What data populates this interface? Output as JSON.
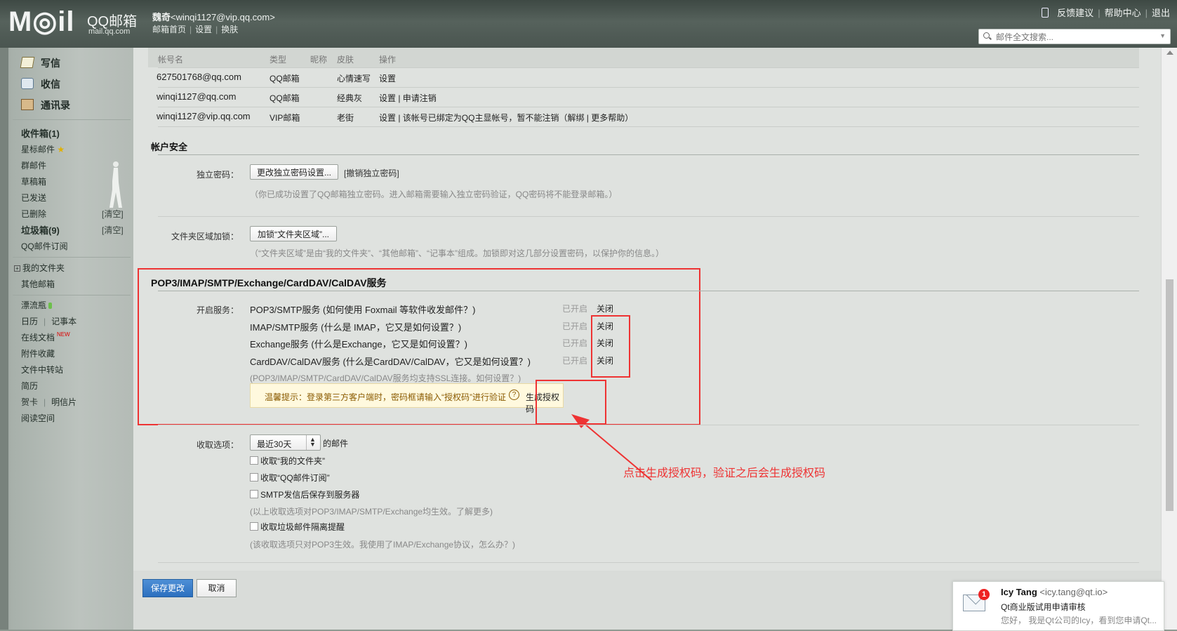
{
  "header": {
    "logo": "M◎il",
    "logo_cn": "QQ邮箱",
    "logo_url": "mail.qq.com",
    "user_name": "魏奇",
    "user_email": "<winqi1127@vip.qq.com>",
    "subnav": [
      "邮箱首页",
      "设置",
      "换肤"
    ],
    "toplinks": [
      "反馈建议",
      "帮助中心",
      "退出"
    ],
    "search_placeholder": "邮件全文搜索..."
  },
  "sidebar": {
    "compose": "写信",
    "receive": "收信",
    "contacts": "通讯录",
    "folders": [
      {
        "label": "收件箱(1)"
      },
      {
        "label": "星标邮件"
      },
      {
        "label": "群邮件"
      },
      {
        "label": "草稿箱"
      },
      {
        "label": "已发送"
      },
      {
        "label": "已删除"
      },
      {
        "label": "垃圾箱(9)"
      },
      {
        "label": "QQ邮件订阅"
      }
    ],
    "clear_label": "[清空]",
    "my_folders": "我的文件夹",
    "other_mail": "其他邮箱",
    "drift_bottle": "漂流瓶",
    "calendar": "日历",
    "notepad": "记事本",
    "online_docs": "在线文档",
    "new_badge": "NEW",
    "attachments": "附件收藏",
    "file_transfer": "文件中转站",
    "resume": "简历",
    "greeting_card": "贺卡",
    "postcard": "明信片",
    "reading_space": "阅读空间"
  },
  "accounts": {
    "headers": [
      "帐号名",
      "类型",
      "昵称",
      "皮肤",
      "操作"
    ],
    "rows": [
      {
        "name": "627501768@qq.com",
        "type": "QQ邮箱",
        "nick": "",
        "skin": "心情速写",
        "ops": "设置"
      },
      {
        "name": "winqi1127@qq.com",
        "type": "QQ邮箱",
        "nick": "",
        "skin": "经典灰",
        "ops": "设置 |  申请注销"
      },
      {
        "name": "winqi1127@vip.qq.com",
        "type": "VIP邮箱",
        "nick": "",
        "skin": "老街",
        "ops": "设置 |  该帐号已绑定为QQ主显帐号，暂不能注销（解绑 | 更多帮助）"
      }
    ]
  },
  "security": {
    "title": "帐户安全",
    "pwd_label": "独立密码：",
    "pwd_button": "更改独立密码设置...",
    "pwd_cancel": "[撤销独立密码]",
    "pwd_hint": "（你已成功设置了QQ邮箱独立密码。进入邮箱需要输入独立密码验证，QQ密码将不能登录邮箱。）",
    "folder_label": "文件夹区域加锁：",
    "folder_button": "加锁“文件夹区域”...",
    "folder_hint": "（“文件夹区域”是由“我的文件夹”、“其他邮箱”、“记事本”组成。加锁即对这几部分设置密码，以保护你的信息。）"
  },
  "services": {
    "title": "POP3/IMAP/SMTP/Exchange/CardDAV/CalDAV服务",
    "label": "开启服务：",
    "items": [
      {
        "name": "POP3/SMTP服务 (如何使用 Foxmail 等软件收发邮件？)",
        "status": "已开启",
        "action": "关闭"
      },
      {
        "name": "IMAP/SMTP服务 (什么是 IMAP，它又是如何设置？)",
        "status": "已开启",
        "action": "关闭"
      },
      {
        "name": "Exchange服务 (什么是Exchange，它又是如何设置？)",
        "status": "已开启",
        "action": "关闭"
      },
      {
        "name": "CardDAV/CalDAV服务 (什么是CardDAV/CalDAV，它又是如何设置？)",
        "status": "已开启",
        "action": "关闭"
      }
    ],
    "ssl_hint": "(POP3/IMAP/SMTP/CardDAV/CalDAV服务均支持SSL连接。如何设置？)",
    "tip": "温馨提示：登录第三方客户端时，密码框请输入“授权码”进行验证",
    "tip_help": "?",
    "gen_code": "生成授权码",
    "annotation": "点击生成授权码，验证之后会生成授权码"
  },
  "receive": {
    "label": "收取选项：",
    "select_value": "最近30天",
    "suffix": "的邮件",
    "options": [
      "收取“我的文件夹”",
      "收取“QQ邮件订阅”",
      "SMTP发信后保存到服务器"
    ],
    "hint1": "(以上收取选项对POP3/IMAP/SMTP/Exchange均生效。了解更多)",
    "spam_option": "收取垃圾邮件隔离提醒",
    "hint2": "(该收取选项只对POP3生效。我使用了IMAP/Exchange协议，怎么办？)"
  },
  "footer": {
    "save": "保存更改",
    "cancel": "取消"
  },
  "notification": {
    "badge": "1",
    "sender": "Icy Tang",
    "sender_email": "<icy.tang@qt.io>",
    "subject": "Qt商业版试用申请审核",
    "preview": "您好， 我是Qt公司的Icy，看到您申请Qt..."
  }
}
